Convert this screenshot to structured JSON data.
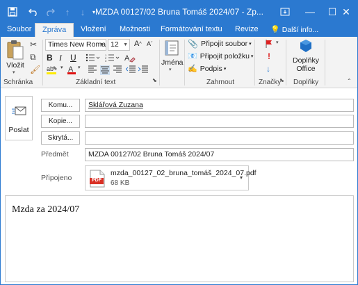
{
  "window": {
    "title": "MZDA 00127/02 Bruna Tomáš 2024/07 - Zp...",
    "accent_color": "#2b79d0",
    "controls": {
      "minimize": "—",
      "restore": "☐",
      "close": "✕"
    }
  },
  "tabs": [
    {
      "label": "Soubor"
    },
    {
      "label": "Zpráva"
    },
    {
      "label": "Vložení"
    },
    {
      "label": "Možnosti"
    },
    {
      "label": "Formátování textu"
    },
    {
      "label": "Revize"
    },
    {
      "label": "Další info..."
    }
  ],
  "ribbon": {
    "clipboard": {
      "paste_label": "Vložit",
      "group_label": "Schránka"
    },
    "basic_text": {
      "font_name": "Times New Roma",
      "font_size": "12",
      "group_label": "Základní text"
    },
    "names": {
      "label": "Jména"
    },
    "include": {
      "attach_file": "Připojit soubor",
      "attach_item": "Připojit položku",
      "signature": "Podpis",
      "group_label": "Zahrnout"
    },
    "tags": {
      "group_label": "Značky"
    },
    "addins": {
      "label_line1": "Doplňky",
      "label_line2": "Office",
      "group_label": "Doplňky"
    }
  },
  "compose": {
    "send_label": "Poslat",
    "to_button": "Komu...",
    "to_value": "Sklářová Zuzana",
    "cc_button": "Kopie...",
    "cc_value": "",
    "bcc_button": "Skrytá...",
    "bcc_value": "",
    "subject_label": "Předmět",
    "subject_value": "MZDA 00127/02 Bruna Tomáš 2024/07",
    "attached_label": "Připojeno",
    "attachment": {
      "badge": "PDF",
      "name": "mzda_00127_02_bruna_tomáš_2024_07.pdf",
      "size": "68 KB"
    },
    "body": "Mzda za 2024/07"
  }
}
